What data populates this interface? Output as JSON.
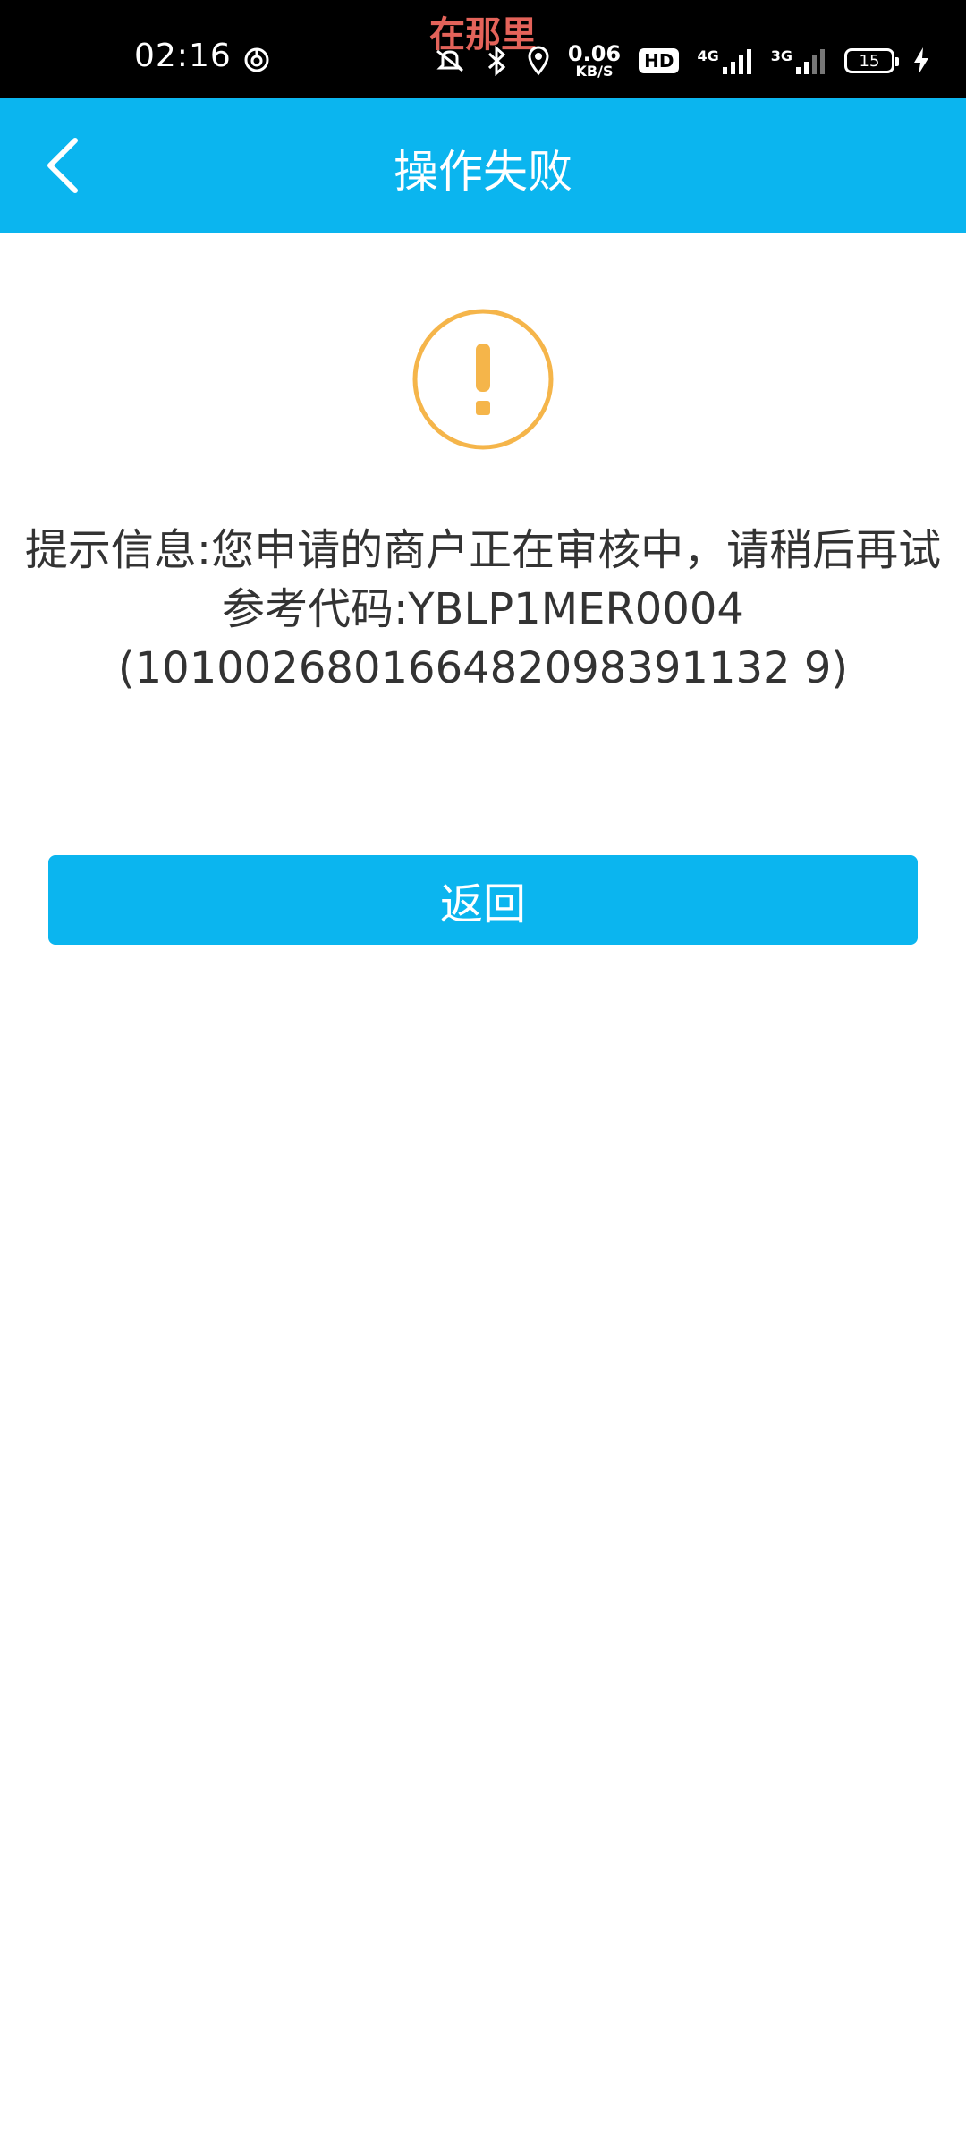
{
  "status_bar": {
    "time": "02:16",
    "carrier_text": "在那里",
    "net_speed_value": "0.06",
    "net_speed_unit": "KB/S",
    "hd_badge": "HD",
    "network_4g": "4G",
    "network_3g": "3G",
    "battery": "15",
    "icons": [
      "ring-icon",
      "mute-icon",
      "bluetooth-icon",
      "location-icon",
      "hd-icon",
      "signal-4g-icon",
      "signal-3g-icon",
      "battery-icon",
      "charging-icon"
    ]
  },
  "header": {
    "title": "操作失败"
  },
  "main": {
    "icon": "exclamation-icon",
    "message_line1": "提示信息:您申请的商户正在审核中，请稍后再试",
    "message_line2": "参考代码:YBLP1MER0004",
    "message_line3": "(101002680166482098391132 9)",
    "return_label": "返回"
  },
  "colors": {
    "accent": "#0bb5ef",
    "warning": "#f5b54a",
    "text": "#333333"
  }
}
